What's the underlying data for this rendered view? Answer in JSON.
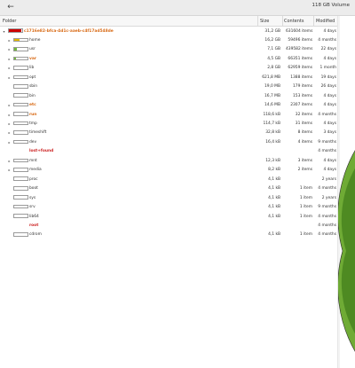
{
  "window": {
    "title": "118 GB Volume",
    "back_icon": "arrow-left-icon"
  },
  "columns": {
    "folder": "Folder",
    "size": "Size",
    "contents": "Contents",
    "modified": "Modified"
  },
  "root": {
    "name": "c1716e82-bfca-4d1c-aaeb-c4f17ad548de",
    "size": "31,2 GB",
    "contents": "631604 items",
    "modified": "4 days",
    "fill": 0.9,
    "fill_color": "#cc0000"
  },
  "rows": [
    {
      "name": "home",
      "size": "16,2 GB",
      "contents": "59496 items",
      "modified": "4 months",
      "expandable": true,
      "fill": 0.4,
      "fill_color": "#e4b800",
      "color": "normal"
    },
    {
      "name": "usr",
      "size": "7,1 GB",
      "contents": "439582 items",
      "modified": "22 days",
      "expandable": true,
      "fill": 0.2,
      "fill_color": "#73b83a",
      "color": "normal"
    },
    {
      "name": "var",
      "size": "4,5 GB",
      "contents": "66351 items",
      "modified": "4 days",
      "expandable": true,
      "fill": 0.13,
      "fill_color": "#73b83a",
      "color": "orange"
    },
    {
      "name": "lib",
      "size": "2,8 GB",
      "contents": "62959 items",
      "modified": "1 month",
      "expandable": true,
      "fill": 0,
      "fill_color": "#73b83a",
      "color": "normal"
    },
    {
      "name": "opt",
      "size": "621,8 MB",
      "contents": "1388 items",
      "modified": "19 days",
      "expandable": true,
      "fill": 0,
      "fill_color": "#73b83a",
      "color": "normal"
    },
    {
      "name": "sbin",
      "size": "19,0 MB",
      "contents": "179 items",
      "modified": "26 days",
      "expandable": false,
      "fill": 0,
      "fill_color": "#73b83a",
      "color": "normal"
    },
    {
      "name": "bin",
      "size": "16,7 MB",
      "contents": "153 items",
      "modified": "4 days",
      "expandable": false,
      "fill": 0,
      "fill_color": "#73b83a",
      "color": "normal"
    },
    {
      "name": "etc",
      "size": "14,6 MB",
      "contents": "2307 items",
      "modified": "4 days",
      "expandable": true,
      "fill": 0,
      "fill_color": "#73b83a",
      "color": "orange"
    },
    {
      "name": "run",
      "size": "118,6 kB",
      "contents": "32 items",
      "modified": "4 months",
      "expandable": true,
      "fill": 0,
      "fill_color": "#73b83a",
      "color": "orange"
    },
    {
      "name": "tmp",
      "size": "114,7 kB",
      "contents": "31 items",
      "modified": "4 days",
      "expandable": true,
      "fill": 0,
      "fill_color": "#73b83a",
      "color": "normal"
    },
    {
      "name": "timeshift",
      "size": "32,8 kB",
      "contents": "8 items",
      "modified": "3 days",
      "expandable": true,
      "fill": 0,
      "fill_color": "#73b83a",
      "color": "normal"
    },
    {
      "name": "dev",
      "size": "16,4 kB",
      "contents": "4 items",
      "modified": "9 months",
      "expandable": true,
      "fill": 0,
      "fill_color": "#73b83a",
      "color": "normal"
    },
    {
      "name": "lost+found",
      "size": "",
      "contents": "",
      "modified": "4 months",
      "expandable": false,
      "fill": 0,
      "fill_color": "#73b83a",
      "color": "red",
      "no_bar": true
    },
    {
      "name": "mnt",
      "size": "12,3 kB",
      "contents": "3 items",
      "modified": "4 days",
      "expandable": true,
      "fill": 0,
      "fill_color": "#73b83a",
      "color": "normal"
    },
    {
      "name": "media",
      "size": "8,2 kB",
      "contents": "2 items",
      "modified": "4 days",
      "expandable": true,
      "fill": 0,
      "fill_color": "#73b83a",
      "color": "normal"
    },
    {
      "name": "proc",
      "size": "4,1 kB",
      "contents": "",
      "modified": "2 years",
      "expandable": false,
      "fill": 0,
      "fill_color": "#73b83a",
      "color": "normal"
    },
    {
      "name": "boot",
      "size": "4,1 kB",
      "contents": "1 item",
      "modified": "4 months",
      "expandable": false,
      "fill": 0,
      "fill_color": "#73b83a",
      "color": "normal"
    },
    {
      "name": "sys",
      "size": "4,1 kB",
      "contents": "1 item",
      "modified": "2 years",
      "expandable": false,
      "fill": 0,
      "fill_color": "#73b83a",
      "color": "normal"
    },
    {
      "name": "srv",
      "size": "4,1 kB",
      "contents": "1 item",
      "modified": "9 months",
      "expandable": false,
      "fill": 0,
      "fill_color": "#73b83a",
      "color": "normal"
    },
    {
      "name": "lib64",
      "size": "4,1 kB",
      "contents": "1 item",
      "modified": "4 months",
      "expandable": false,
      "fill": 0,
      "fill_color": "#73b83a",
      "color": "normal"
    },
    {
      "name": "root",
      "size": "",
      "contents": "",
      "modified": "4 months",
      "expandable": false,
      "fill": 0,
      "fill_color": "#73b83a",
      "color": "red",
      "no_bar": true
    },
    {
      "name": "cdrom",
      "size": "4,1 kB",
      "contents": "1 item",
      "modified": "4 months",
      "expandable": false,
      "fill": 0,
      "fill_color": "#73b83a",
      "color": "normal"
    }
  ],
  "colors": {
    "red": "#cc2222",
    "orange": "#d86a15",
    "green": "#6fab35",
    "dark_green": "#4e8a22"
  }
}
